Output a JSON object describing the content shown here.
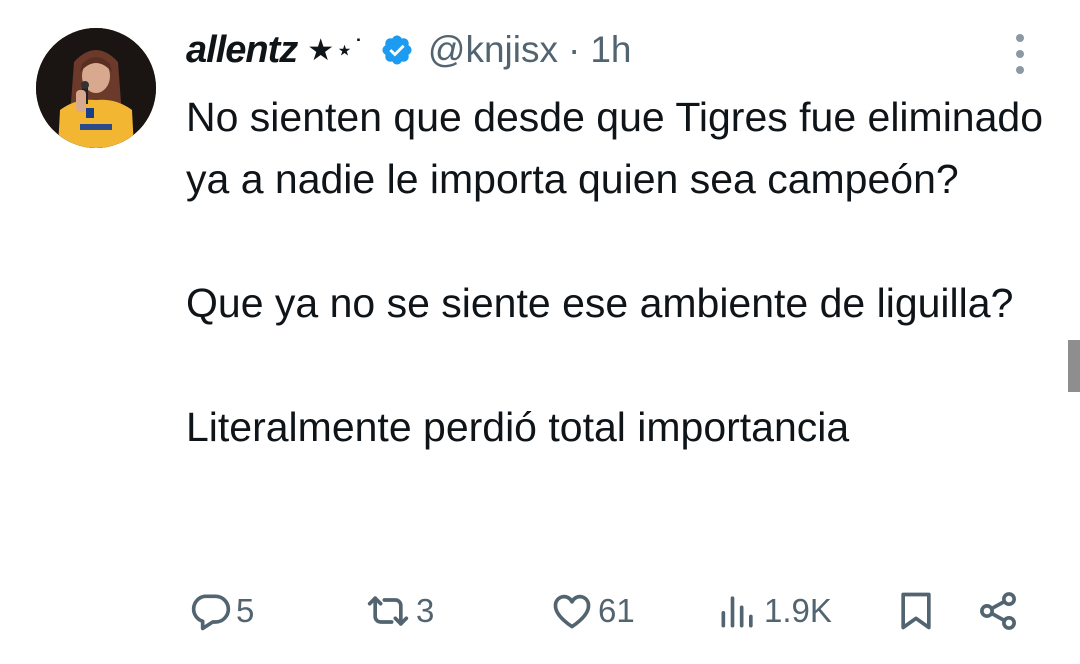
{
  "tweet": {
    "author_name": "allentz",
    "name_emoji": "★⋆˙",
    "handle": "@knjisx",
    "separator": "·",
    "time": "1h",
    "text": "No sienten que desde que Tigres fue eliminado ya a nadie le importa quien sea campeón?\n\nQue ya no se siente ese ambiente de liguilla?\n\nLiteralmente perdió total importancia"
  },
  "actions": {
    "replies": "5",
    "reposts": "3",
    "likes": "61",
    "views": "1.9K"
  },
  "colors": {
    "text": "#0f1419",
    "muted": "#536471",
    "verified": "#1d9bf0",
    "jersey": "#f2b632"
  },
  "icons": [
    "verified-badge-icon",
    "more-icon",
    "reply-icon",
    "repost-icon",
    "like-icon",
    "views-icon",
    "bookmark-icon",
    "share-icon"
  ]
}
